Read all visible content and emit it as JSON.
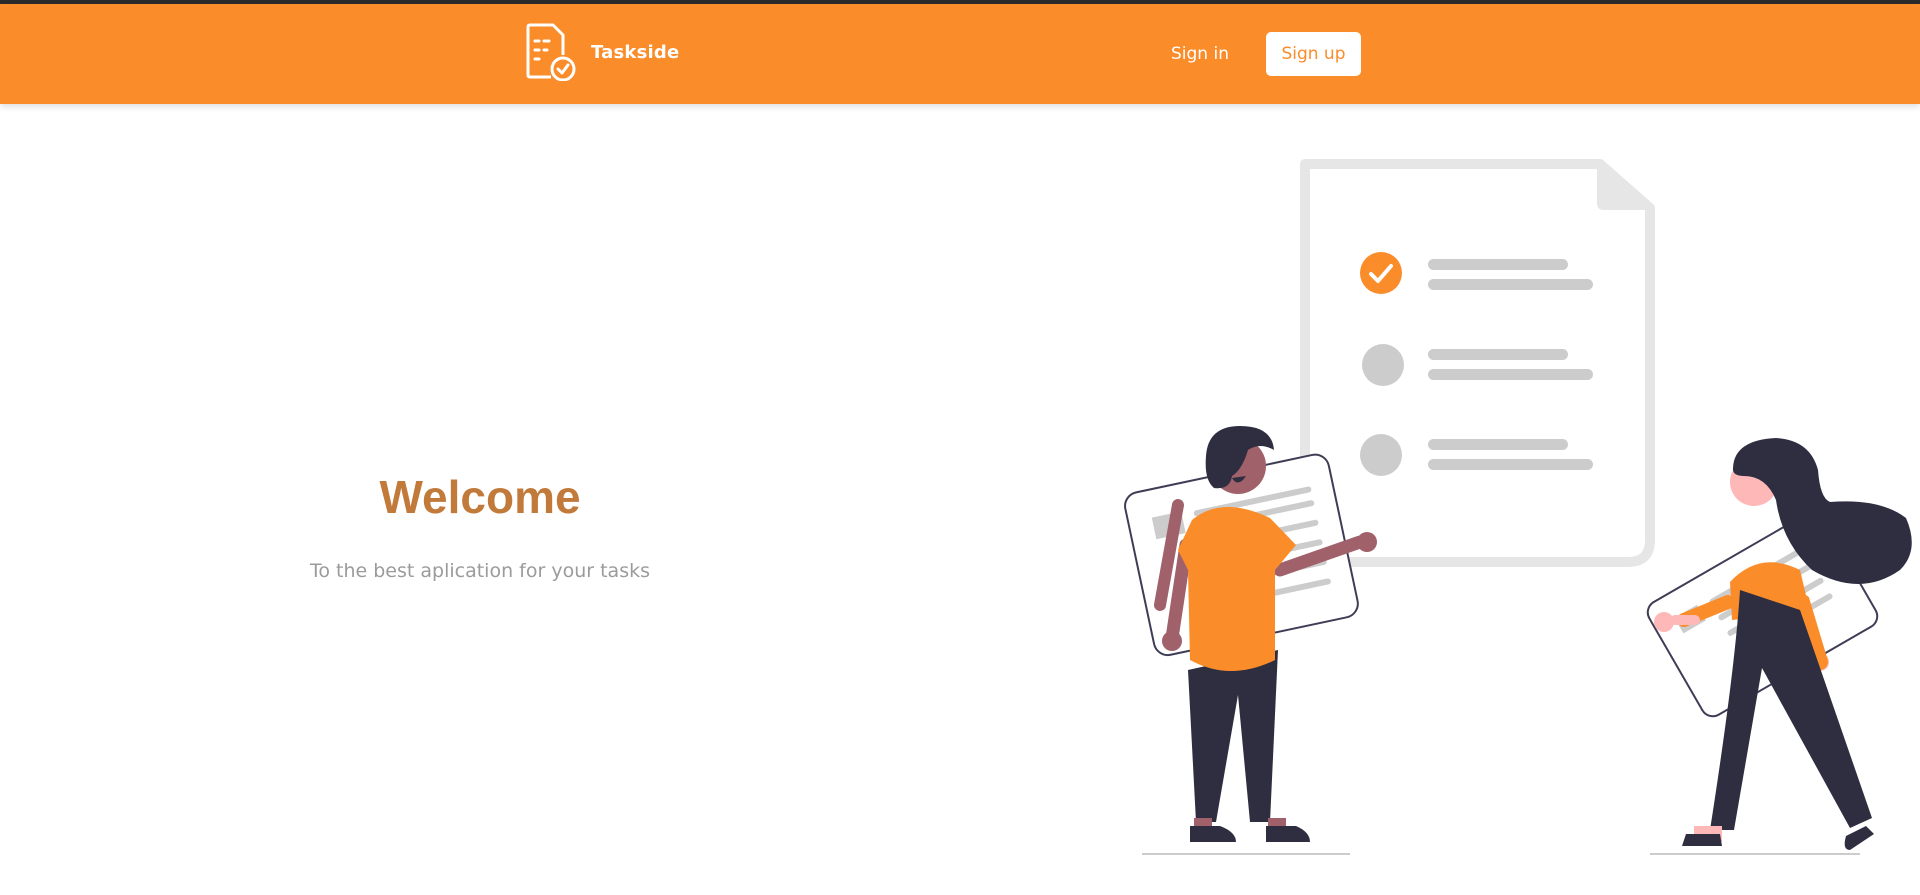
{
  "header": {
    "brand_name": "Taskside",
    "signin_label": "Sign in",
    "signup_label": "Sign up"
  },
  "hero": {
    "title": "Welcome",
    "subtitle": "To the best aplication for your tasks"
  },
  "illustration": {
    "tasks": [
      {
        "status": "done"
      },
      {
        "status": "pending"
      },
      {
        "status": "pending"
      }
    ]
  },
  "colors": {
    "accent": "#fb8c2a",
    "title": "#c17a3a",
    "subtitle": "#9b9b9b",
    "dark": "#2f2e41",
    "skin_dark": "#a0616a",
    "skin_light": "#ffb8b8"
  },
  "icons": [
    "task-document-icon",
    "checkmark-icon"
  ]
}
